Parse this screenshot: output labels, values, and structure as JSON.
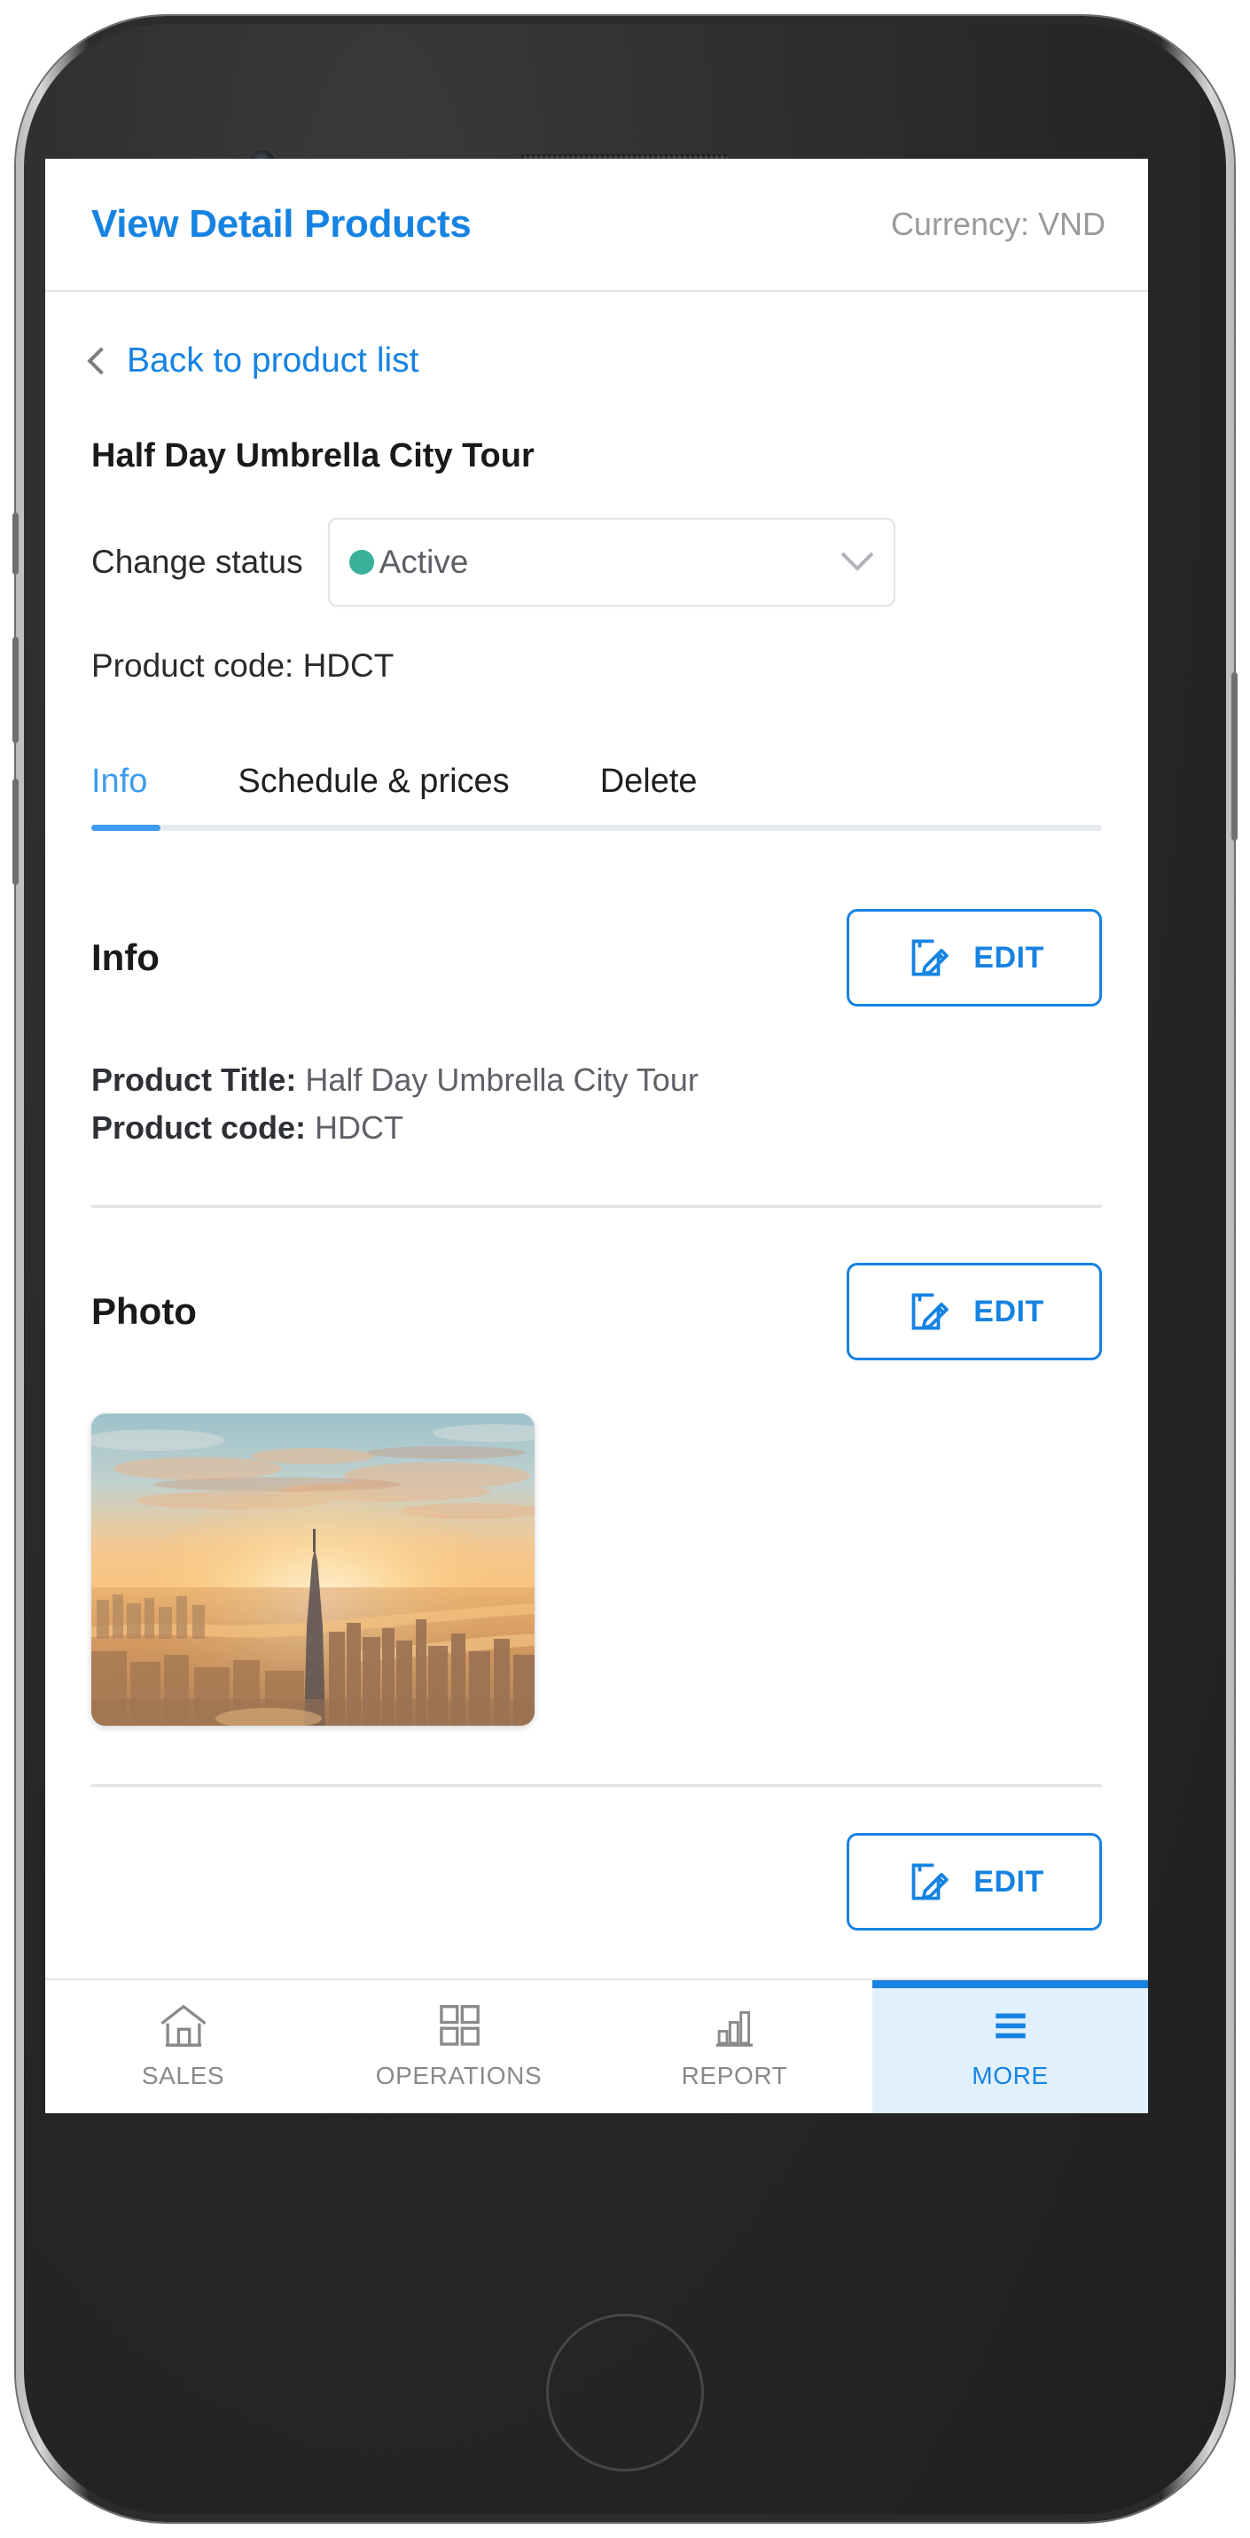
{
  "app": {
    "topbar": {
      "title": "View Detail Products",
      "currency": "Currency: VND"
    },
    "back_link": {
      "label": "Back to product list",
      "icon": "chevron-left-icon"
    },
    "product": {
      "heading": "Half Day Umbrella City Tour",
      "status_label": "Change status",
      "status_value": "Active",
      "status_dot_color": "#3aaf9a",
      "status_caret_icon": "chevron-down-icon",
      "product_code_line": "Product code: HDCT"
    },
    "tabs": [
      {
        "label": "Info",
        "active": true
      },
      {
        "label": "Schedule & prices",
        "active": false
      },
      {
        "label": "Delete",
        "active": false
      }
    ],
    "info_section": {
      "title": "Info",
      "edit_label": "EDIT",
      "edit_icon": "pencil-document-icon",
      "fields": [
        {
          "key": "Product Title:",
          "value": "Half Day Umbrella City Tour"
        },
        {
          "key": "Product code:",
          "value": "HDCT"
        }
      ]
    },
    "photo_section": {
      "title": "Photo",
      "edit_label": "EDIT",
      "edit_icon": "pencil-document-icon",
      "thumbnail_alt": "City skyline at sunset with tall tower"
    },
    "next_section": {
      "edit_label": "EDIT",
      "edit_icon": "pencil-document-icon"
    },
    "bottom_nav": [
      {
        "label": "SALES",
        "icon": "home-icon",
        "active": false
      },
      {
        "label": "OPERATIONS",
        "icon": "grid-icon",
        "active": false
      },
      {
        "label": "REPORT",
        "icon": "bar-chart-icon",
        "active": false
      },
      {
        "label": "MORE",
        "icon": "hamburger-icon",
        "active": true
      }
    ],
    "colors": {
      "accent": "#1683e2",
      "tab_active": "#3e9bf0",
      "status_green": "#3aaf9a",
      "muted_text": "#9a9a9a",
      "nav_inactive": "#8a8a8a",
      "nav_active_bg": "#e1f0fd"
    }
  }
}
